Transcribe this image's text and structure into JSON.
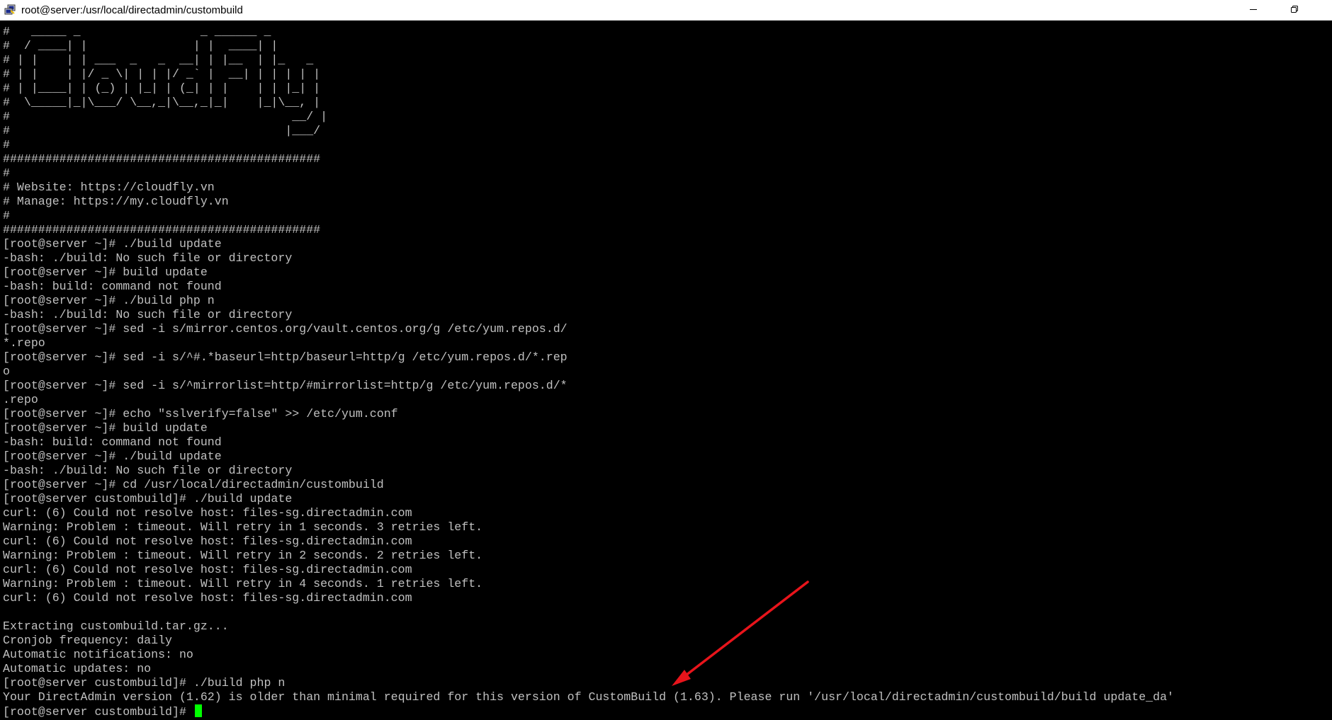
{
  "window": {
    "title": "root@server:/usr/local/directadmin/custombuild",
    "icon": "putty-icon",
    "controls": [
      "minimize-icon",
      "restore-icon"
    ]
  },
  "terminal": {
    "lines": [
      "#   _____ _                 _ ______ _",
      "#  / ____| |               | |  ____| |",
      "# | |    | | ___  _   _  __| | |__  | |_   _",
      "# | |    | |/ _ \\| | | |/ _` |  __| | | | | |",
      "# | |____| | (_) | |_| | (_| | |    | | |_| |",
      "#  \\_____|_|\\___/ \\__,_|\\__,_|_|    |_|\\__, |",
      "#                                        __/ |",
      "#                                       |___/",
      "#",
      "#############################################",
      "#",
      "# Website: https://cloudfly.vn",
      "# Manage: https://my.cloudfly.vn",
      "#",
      "#############################################",
      "[root@server ~]# ./build update",
      "-bash: ./build: No such file or directory",
      "[root@server ~]# build update",
      "-bash: build: command not found",
      "[root@server ~]# ./build php n",
      "-bash: ./build: No such file or directory",
      "[root@server ~]# sed -i s/mirror.centos.org/vault.centos.org/g /etc/yum.repos.d/",
      "*.repo",
      "[root@server ~]# sed -i s/^#.*baseurl=http/baseurl=http/g /etc/yum.repos.d/*.rep",
      "o",
      "[root@server ~]# sed -i s/^mirrorlist=http/#mirrorlist=http/g /etc/yum.repos.d/*",
      ".repo",
      "[root@server ~]# echo \"sslverify=false\" >> /etc/yum.conf",
      "[root@server ~]# build update",
      "-bash: build: command not found",
      "[root@server ~]# ./build update",
      "-bash: ./build: No such file or directory",
      "[root@server ~]# cd /usr/local/directadmin/custombuild",
      "[root@server custombuild]# ./build update",
      "curl: (6) Could not resolve host: files-sg.directadmin.com",
      "Warning: Problem : timeout. Will retry in 1 seconds. 3 retries left.",
      "curl: (6) Could not resolve host: files-sg.directadmin.com",
      "Warning: Problem : timeout. Will retry in 2 seconds. 2 retries left.",
      "curl: (6) Could not resolve host: files-sg.directadmin.com",
      "Warning: Problem : timeout. Will retry in 4 seconds. 1 retries left.",
      "curl: (6) Could not resolve host: files-sg.directadmin.com",
      "",
      "Extracting custombuild.tar.gz...",
      "Cronjob frequency: daily",
      "Automatic notifications: no",
      "Automatic updates: no",
      "[root@server custombuild]# ./build php n",
      "Your DirectAdmin version (1.62) is older than minimal required for this version of CustomBuild (1.63). Please run '/usr/local/directadmin/custombuild/build update_da'"
    ],
    "prompt": "[root@server custombuild]# ",
    "colors": {
      "background": "#000000",
      "foreground": "#c0c0c0",
      "cursor": "#00ff00",
      "annotation_arrow": "#e8141b"
    }
  }
}
